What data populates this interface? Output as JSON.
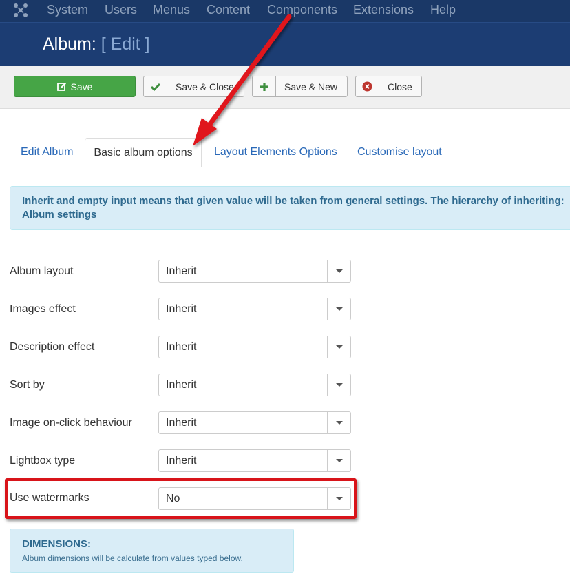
{
  "navbar": {
    "items": [
      "System",
      "Users",
      "Menus",
      "Content",
      "Components",
      "Extensions",
      "Help"
    ]
  },
  "header": {
    "title": "Album:",
    "mode": "[ Edit ]"
  },
  "toolbar": {
    "save_label": "Save",
    "save_close_label": "Save & Close",
    "save_new_label": "Save & New",
    "close_label": "Close"
  },
  "tabs": [
    {
      "label": "Edit Album"
    },
    {
      "label": "Basic album options"
    },
    {
      "label": "Layout Elements Options"
    },
    {
      "label": "Customise layout"
    }
  ],
  "info_alert": {
    "text": "Inherit and empty input means that given value will be taken from general settings. The hierarchy of inheriting: Album settings"
  },
  "fields": [
    {
      "label": "Album layout",
      "value": "Inherit"
    },
    {
      "label": "Images effect",
      "value": "Inherit"
    },
    {
      "label": "Description effect",
      "value": "Inherit"
    },
    {
      "label": "Sort by",
      "value": "Inherit"
    },
    {
      "label": "Image on-click behaviour",
      "value": "Inherit"
    },
    {
      "label": "Lightbox type",
      "value": "Inherit"
    },
    {
      "label": "Use watermarks",
      "value": "No"
    }
  ],
  "dimensions": {
    "title": "DIMENSIONS:",
    "description": "Album dimensions will be calculate from values typed below."
  },
  "colors": {
    "navbar": "#1a3867",
    "header": "#1c3d73",
    "save_button": "#46a546",
    "link": "#2a69b8",
    "alert_bg": "#d9edf7",
    "highlight": "#d8141a"
  }
}
